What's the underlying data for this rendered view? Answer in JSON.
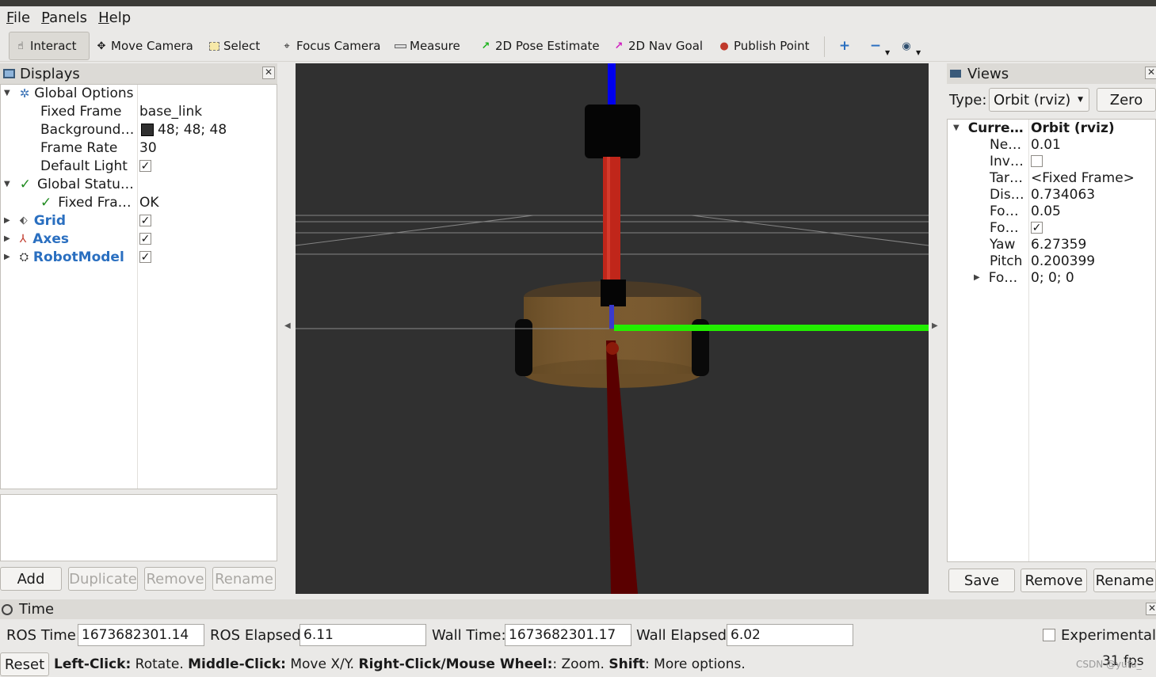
{
  "window": {
    "title": ""
  },
  "menu": [
    {
      "key": "F",
      "rest": "ile"
    },
    {
      "key": "P",
      "rest": "anels"
    },
    {
      "key": "H",
      "rest": "elp"
    }
  ],
  "toolbar": {
    "interact": "Interact",
    "move_camera": "Move Camera",
    "select": "Select",
    "focus_camera": "Focus Camera",
    "measure": "Measure",
    "pose_estimate": "2D Pose Estimate",
    "nav_goal": "2D Nav Goal",
    "publish_point": "Publish Point"
  },
  "displays": {
    "title": "Displays",
    "rows": {
      "global_options": "Global Options",
      "fixed_frame": "Fixed Frame",
      "fixed_frame_val": "base_link",
      "background": "Background…",
      "background_val": "48; 48; 48",
      "frame_rate": "Frame Rate",
      "frame_rate_val": "30",
      "default_light": "Default Light",
      "global_status": "Global Statu…",
      "status_fixed_frame": "Fixed Fra…",
      "status_fixed_frame_val": "OK",
      "grid": "Grid",
      "axes": "Axes",
      "robot_model": "RobotModel"
    },
    "buttons": {
      "add": "Add",
      "duplicate": "Duplicate",
      "remove": "Remove",
      "rename": "Rename"
    }
  },
  "views": {
    "title": "Views",
    "type_label": "Type:",
    "type_value": "Orbit (rviz)",
    "zero": "Zero",
    "rows": {
      "current": "Curre…",
      "current_val": "Orbit (rviz)",
      "near": "Ne…",
      "near_val": "0.01",
      "invert": "Inv…",
      "target": "Tar…",
      "target_val": "<Fixed Frame>",
      "distance": "Dis…",
      "distance_val": "0.734063",
      "focal_size": "Fo…",
      "focal_size_val": "0.05",
      "focal_shape": "Fo…",
      "yaw": "Yaw",
      "yaw_val": "6.27359",
      "pitch": "Pitch",
      "pitch_val": "0.200399",
      "focal_point": "Fo…",
      "focal_point_val": "0; 0; 0"
    },
    "buttons": {
      "save": "Save",
      "remove": "Remove",
      "rename": "Rename"
    }
  },
  "time": {
    "title": "Time",
    "ros_time_label": "ROS Time:",
    "ros_time": "1673682301.14",
    "ros_elapsed_label": "ROS Elapsed:",
    "ros_elapsed": "6.11",
    "wall_time_label": "Wall Time:",
    "wall_time": "1673682301.17",
    "wall_elapsed_label": "Wall Elapsed:",
    "wall_elapsed": "6.02",
    "experimental": "Experimental"
  },
  "status": {
    "reset": "Reset",
    "h1": "Left-Click:",
    "t1": " Rotate. ",
    "h2": "Middle-Click:",
    "t2": " Move X/Y. ",
    "h3": "Right-Click/Mouse Wheel:",
    "t3": ": Zoom. ",
    "h4": "Shift",
    "t4": ": More options.",
    "fps": "31 fps",
    "watermark": "CSDN @yufu_"
  },
  "colors": {
    "background": "#303030",
    "axis_x": "#cc1a1a",
    "axis_y": "#22ee00",
    "axis_z": "#0000ee",
    "link_label": "#2a6fc0"
  }
}
